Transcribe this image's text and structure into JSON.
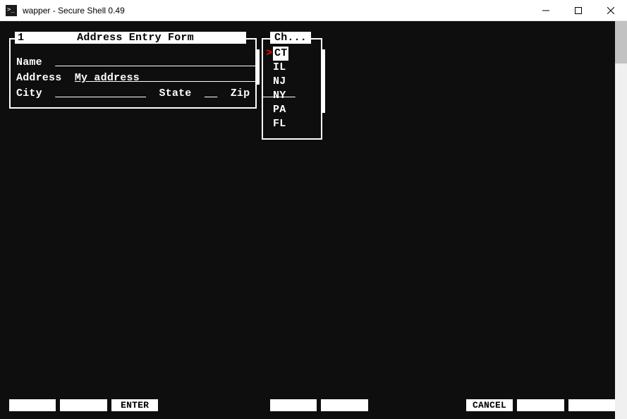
{
  "window": {
    "title": "wapper - Secure Shell 0.49"
  },
  "form": {
    "page": "1",
    "title": "Address Entry Form",
    "name_label": "Name",
    "name_value": "",
    "address_label": "Address",
    "address_value": "My address",
    "city_label": "City",
    "city_value": "",
    "state_label": "State",
    "state_value": "",
    "zip_label": "Zip",
    "zip_value": ""
  },
  "popup": {
    "title": "Ch...",
    "selected_index": 0,
    "items": [
      "CT",
      "IL",
      "NJ",
      "NY",
      "PA",
      "FL"
    ]
  },
  "fkeys": {
    "k1": "",
    "k2": "",
    "k3": "ENTER",
    "k4": "",
    "k5": "",
    "k6": "CANCEL",
    "k7": "",
    "k8": ""
  }
}
